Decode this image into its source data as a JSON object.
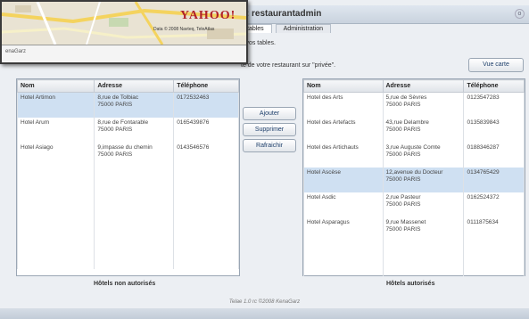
{
  "window": {
    "title": "r: restaurantadmin",
    "close_glyph": "o"
  },
  "tabs": [
    {
      "label": "tables"
    },
    {
      "label": "Administration"
    }
  ],
  "info_line1": "s vos tables.",
  "info_line2": "te de votre restaurant sur \"privée\".",
  "buttons": {
    "map": "Vue carte",
    "add": "Ajouter",
    "remove": "Supprimer",
    "refresh": "Rafraichir"
  },
  "columns": [
    "Nom",
    "Adresse",
    "Téléphone"
  ],
  "left_table": {
    "caption": "Hôtels non autorisés",
    "rows": [
      {
        "name": "Hotel Artimon",
        "addr1": "8,rue de Tolbiac",
        "addr2": "75000 PARIS",
        "phone": "0172532463"
      },
      {
        "name": "Hotel Arum",
        "addr1": "8,rue de Fontarable",
        "addr2": "75000 PARIS",
        "phone": "0165439876"
      },
      {
        "name": "Hotel Asiago",
        "addr1": "9,impasse du chemin",
        "addr2": "75000 PARIS",
        "phone": "0143546576"
      }
    ]
  },
  "right_table": {
    "caption": "Hôtels autorisés",
    "rows": [
      {
        "name": "Hotel des Arts",
        "addr1": "5,rue de Sèvres",
        "addr2": "75000 PARIS",
        "phone": "0123547283"
      },
      {
        "name": "Hotel des Artefacts",
        "addr1": "43,rue Delambre",
        "addr2": "75000 PARIS",
        "phone": "0135839843"
      },
      {
        "name": "Hotel des Artichauts",
        "addr1": "3,rue Auguste Comte",
        "addr2": "75000 PARIS",
        "phone": "0188346287"
      },
      {
        "name": "Hotel Ascèse",
        "addr1": "12,avenue du Docteur",
        "addr2": "75000 PARIS",
        "phone": "0134765429"
      },
      {
        "name": "Hotel Asdic",
        "addr1": "2,rue Pasteur",
        "addr2": "75000 PARIS",
        "phone": "0162524372"
      },
      {
        "name": "Hotel Asparagus",
        "addr1": "9,rue Massenet",
        "addr2": "75000 PARIS",
        "phone": "0111875634"
      }
    ]
  },
  "footer": "Telae 1.0 rc   ©2008 KenaGarz",
  "map": {
    "logo": "YAHOO!",
    "copyright": "Data © 2008 Navteq, TeleAtlas",
    "footer": "enaGarz"
  }
}
